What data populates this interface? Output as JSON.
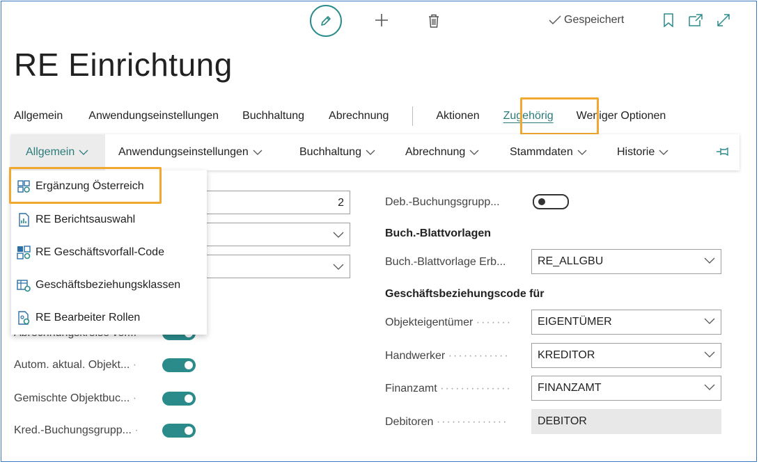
{
  "header": {
    "saved_label": "Gespeichert",
    "title": "RE Einrichtung"
  },
  "menu": {
    "items": [
      "Allgemein",
      "Anwendungseinstellungen",
      "Buchhaltung",
      "Abrechnung",
      "Aktionen",
      "Zugehörig",
      "Weniger Optionen"
    ]
  },
  "submenu": {
    "items": [
      "Allgemein",
      "Anwendungseinstellungen",
      "Buchhaltung",
      "Abrechnung",
      "Stammdaten",
      "Historie"
    ]
  },
  "dropdown": {
    "items": [
      "Ergänzung Österreich",
      "RE Berichtsauswahl",
      "RE Geschäftsvorfall-Code",
      "Geschäftsbeziehungsklassen",
      "RE Bearbeiter Rollen"
    ]
  },
  "left": {
    "number_value": "2",
    "labels": [
      "Abrechnungskreise ver...",
      "Autom. aktual. Objekt...",
      "Gemischte Objektbuc...",
      "Kred.-Buchungsgrupp..."
    ]
  },
  "right": {
    "deb_label": "Deb.-Buchungsgrupp...",
    "section1": "Buch.-Blattvorlagen",
    "blatt_label": "Buch.-Blattvorlage Erb...",
    "blatt_value": "RE_ALLGBU",
    "section2": "Geschäftsbeziehungscode für",
    "fields": [
      {
        "label": "Objekteigentümer",
        "value": "EIGENTÜMER"
      },
      {
        "label": "Handwerker",
        "value": "KREDITOR"
      },
      {
        "label": "Finanzamt",
        "value": "FINANZAMT"
      },
      {
        "label": "Debitoren",
        "value": "DEBITOR"
      }
    ]
  },
  "colors": {
    "accent": "#2b8a8a",
    "highlight": "#f0a830",
    "frame": "#3a78c3"
  }
}
